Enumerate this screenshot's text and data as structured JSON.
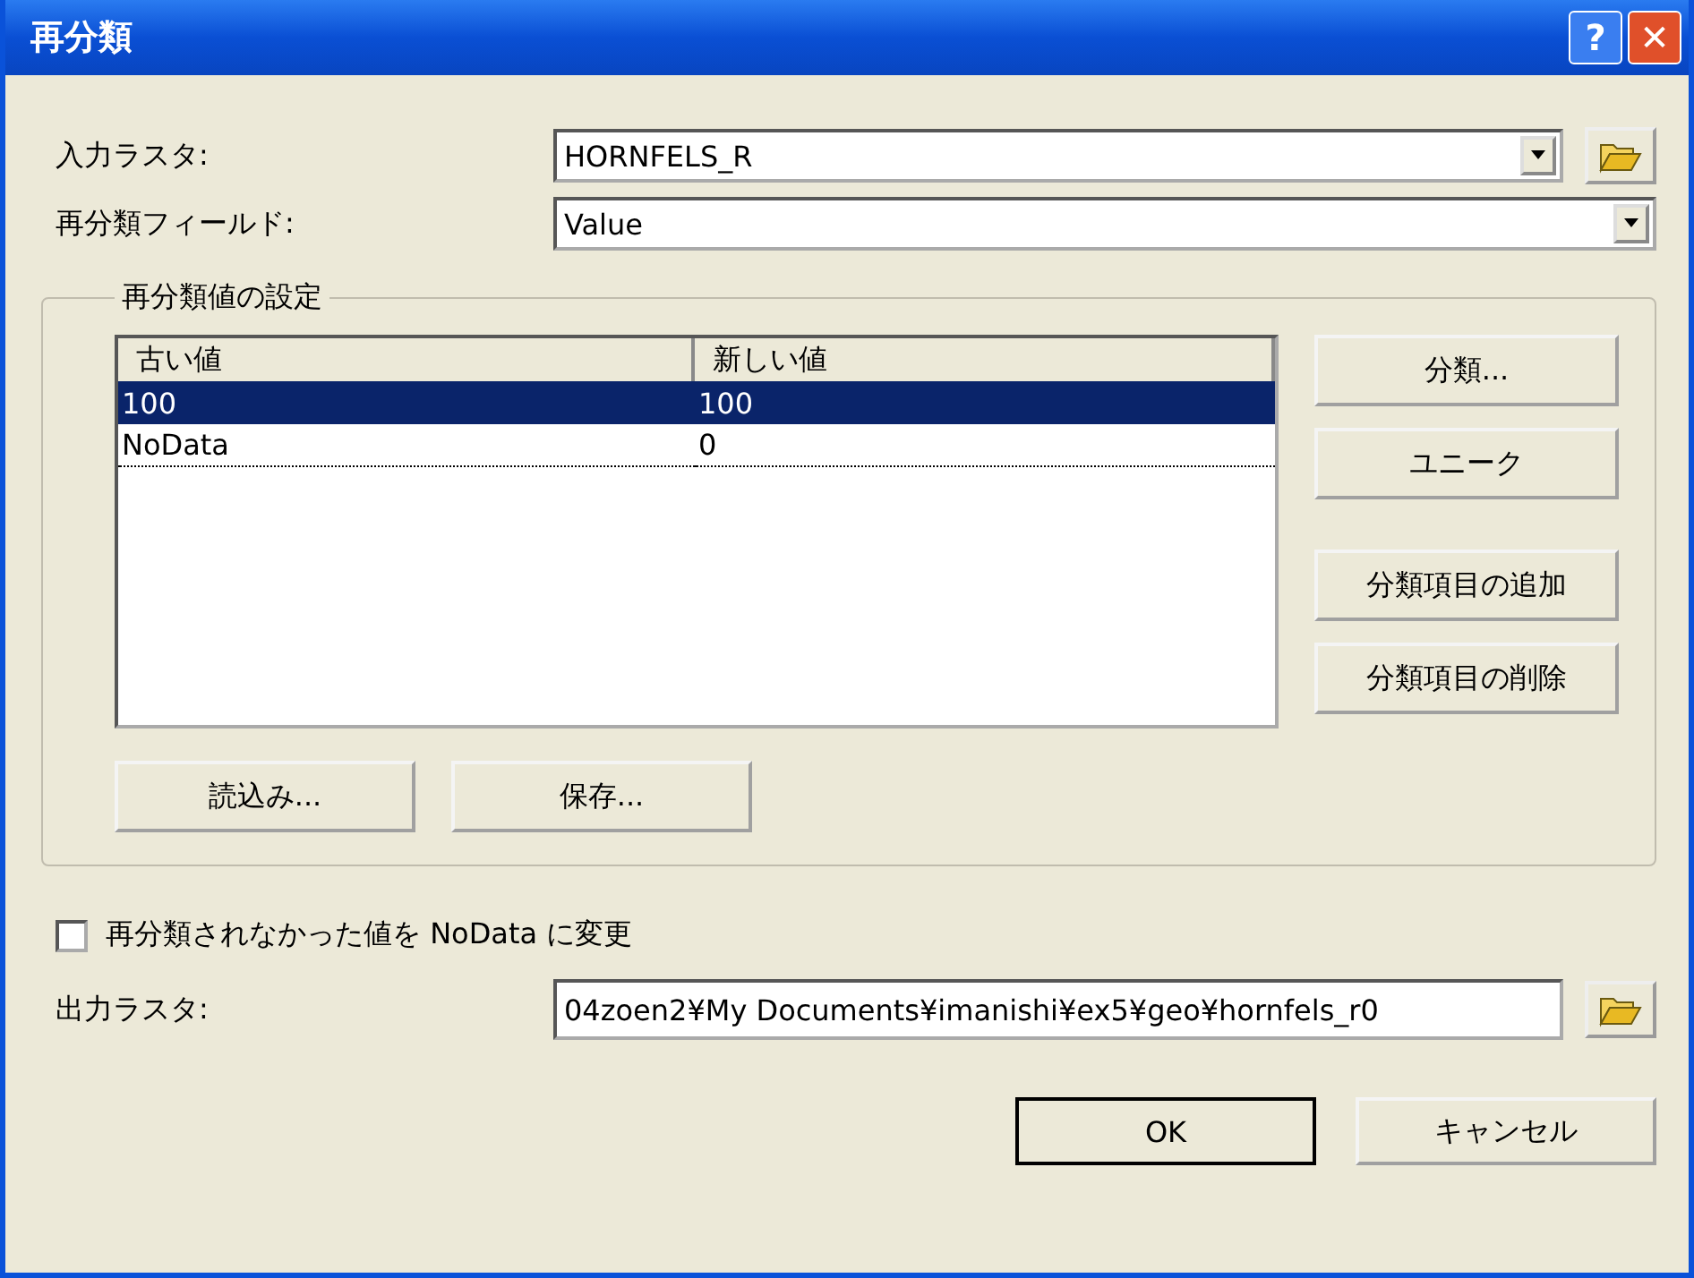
{
  "window": {
    "title": "再分類",
    "buttons": [
      {
        "kind": "help",
        "label": "?"
      },
      {
        "kind": "close",
        "label": "✕"
      }
    ]
  },
  "input_raster": {
    "label": "入力ラスタ:",
    "value": "HORNFELS_R"
  },
  "reclass_field": {
    "label": "再分類フィールド:",
    "value": "Value"
  },
  "reclass_group": {
    "title": "再分類値の設定",
    "table": {
      "columns": [
        "古い値",
        "新しい値"
      ],
      "rows": [
        {
          "cells": [
            "100",
            "100"
          ],
          "selected": true
        },
        {
          "cells": [
            "NoData",
            "0"
          ],
          "selected": false
        }
      ]
    },
    "side_buttons": [
      "分類...",
      "ユニーク",
      "分類項目の追加",
      "分類項目の削除"
    ],
    "bottom_buttons": [
      "読込み...",
      "保存..."
    ]
  },
  "nodata_checkbox": {
    "label": "再分類されなかった値を NoData に変更",
    "checked": false
  },
  "output_raster": {
    "label": "出力ラスタ:",
    "value": "04zoen2¥My Documents¥imanishi¥ex5¥geo¥hornfels_r0"
  },
  "buttons": [
    {
      "label": "OK",
      "default": true
    },
    {
      "label": "キャンセル",
      "default": false
    }
  ]
}
